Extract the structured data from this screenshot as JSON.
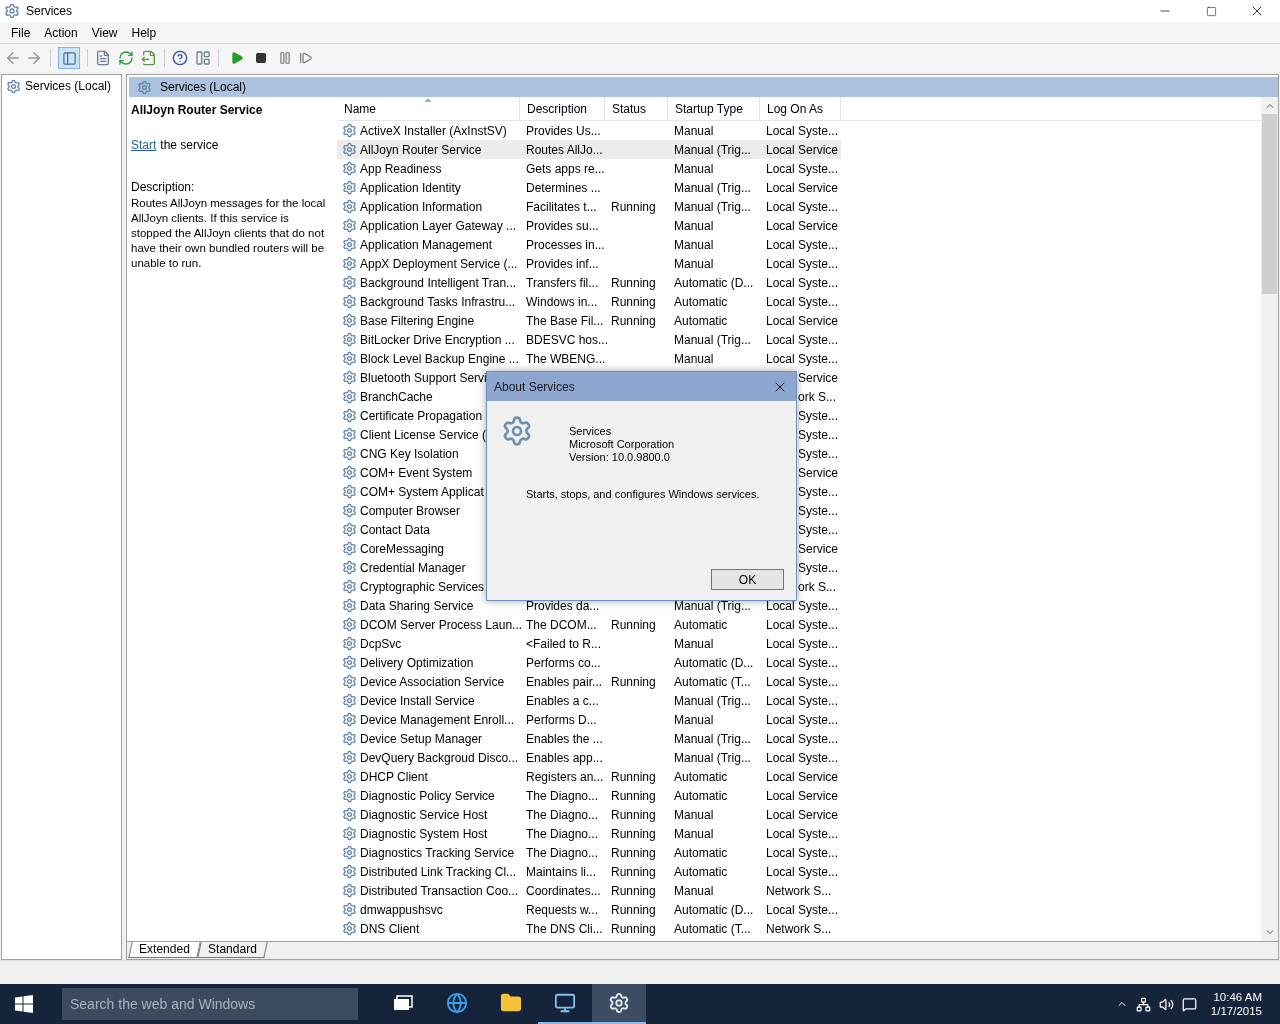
{
  "window": {
    "title": "Services"
  },
  "menu": [
    {
      "label": "File"
    },
    {
      "label": "Action"
    },
    {
      "label": "View"
    },
    {
      "label": "Help"
    }
  ],
  "toolbar": {
    "console_tree_shown": true
  },
  "tree": [
    {
      "label": "Services (Local)"
    }
  ],
  "panel": {
    "title": "Services (Local)",
    "service_name": "AllJoyn Router Service",
    "start_link": "Start",
    "start_suffix": "the service",
    "description_label": "Description:",
    "description": "Routes AllJoyn messages for the local AllJoyn clients. If this service is stopped the AllJoyn clients that do not have their own bundled routers will be unable to run."
  },
  "table": {
    "columns": [
      {
        "label": "Name",
        "sorted": true
      },
      {
        "label": "Description",
        "sorted": false
      },
      {
        "label": "Status",
        "sorted": false
      },
      {
        "label": "Startup Type",
        "sorted": false
      },
      {
        "label": "Log On As",
        "sorted": false
      }
    ],
    "rows": [
      {
        "name": "ActiveX Installer (AxInstSV)",
        "description": "Provides Us...",
        "startup_type": "Manual",
        "log_on_as": "Local Syste...",
        "selected": false
      },
      {
        "name": "AllJoyn Router Service",
        "description": "Routes AllJo...",
        "startup_type": "Manual (Trig...",
        "log_on_as": "Local Service",
        "selected": true
      },
      {
        "name": "App Readiness",
        "description": "Gets apps re...",
        "startup_type": "Manual",
        "log_on_as": "Local Syste...",
        "selected": false
      },
      {
        "name": "Application Identity",
        "description": "Determines ...",
        "startup_type": "Manual (Trig...",
        "log_on_as": "Local Service",
        "selected": false
      },
      {
        "name": "Application Information",
        "description": "Facilitates t...",
        "status": "Running",
        "startup_type": "Manual (Trig...",
        "log_on_as": "Local Syste...",
        "selected": false
      },
      {
        "name": "Application Layer Gateway ...",
        "description": "Provides su...",
        "startup_type": "Manual",
        "log_on_as": "Local Service",
        "selected": false
      },
      {
        "name": "Application Management",
        "description": "Processes in...",
        "startup_type": "Manual",
        "log_on_as": "Local Syste...",
        "selected": false
      },
      {
        "name": "AppX Deployment Service (...",
        "description": "Provides inf...",
        "startup_type": "Manual",
        "log_on_as": "Local Syste...",
        "selected": false
      },
      {
        "name": "Background Intelligent Tran...",
        "description": "Transfers fil...",
        "status": "Running",
        "startup_type": "Automatic (D...",
        "log_on_as": "Local Syste...",
        "selected": false
      },
      {
        "name": "Background Tasks Infrastru...",
        "description": "Windows in...",
        "status": "Running",
        "startup_type": "Automatic",
        "log_on_as": "Local Syste...",
        "selected": false
      },
      {
        "name": "Base Filtering Engine",
        "description": "The Base Fil...",
        "status": "Running",
        "startup_type": "Automatic",
        "log_on_as": "Local Service",
        "selected": false
      },
      {
        "name": "BitLocker Drive Encryption ...",
        "description": "BDESVC hos...",
        "startup_type": "Manual (Trig...",
        "log_on_as": "Local Syste...",
        "selected": false
      },
      {
        "name": "Block Level Backup Engine ...",
        "description": "The WBENG...",
        "startup_type": "Manual",
        "log_on_as": "Local Syste...",
        "selected": false
      },
      {
        "name": "Bluetooth Support Servi",
        "log_on_as": "Service",
        "selected": false
      },
      {
        "name": "BranchCache",
        "log_on_as": "ork S...",
        "selected": false
      },
      {
        "name": "Certificate Propagation",
        "log_on_as": "Syste...",
        "selected": false
      },
      {
        "name": "Client License Service (",
        "log_on_as": "Syste...",
        "selected": false
      },
      {
        "name": "CNG Key Isolation",
        "log_on_as": "Syste...",
        "selected": false
      },
      {
        "name": "COM+ Event System",
        "log_on_as": "Service",
        "selected": false
      },
      {
        "name": "COM+ System Applicat",
        "log_on_as": "Syste...",
        "selected": false
      },
      {
        "name": "Computer Browser",
        "log_on_as": "Syste...",
        "selected": false
      },
      {
        "name": "Contact Data",
        "log_on_as": "Syste...",
        "selected": false
      },
      {
        "name": "CoreMessaging",
        "log_on_as": "Service",
        "selected": false
      },
      {
        "name": "Credential Manager",
        "log_on_as": "Syste...",
        "selected": false
      },
      {
        "name": "Cryptographic Services",
        "log_on_as": "ork S...",
        "selected": false
      },
      {
        "name": "Data Sharing Service",
        "description": "Provides da...",
        "startup_type": "Manual (Trig...",
        "log_on_as": "Local Syste...",
        "selected": false
      },
      {
        "name": "DCOM Server Process Laun...",
        "description": "The DCOM...",
        "status": "Running",
        "startup_type": "Automatic",
        "log_on_as": "Local Syste...",
        "selected": false
      },
      {
        "name": "DcpSvc",
        "description": "<Failed to R...",
        "startup_type": "Manual",
        "log_on_as": "Local Syste...",
        "selected": false
      },
      {
        "name": "Delivery Optimization",
        "description": "Performs co...",
        "startup_type": "Automatic (D...",
        "log_on_as": "Local Syste...",
        "selected": false
      },
      {
        "name": "Device Association Service",
        "description": "Enables pair...",
        "status": "Running",
        "startup_type": "Automatic (T...",
        "log_on_as": "Local Syste...",
        "selected": false
      },
      {
        "name": "Device Install Service",
        "description": "Enables a c...",
        "startup_type": "Manual (Trig...",
        "log_on_as": "Local Syste...",
        "selected": false
      },
      {
        "name": "Device Management Enroll...",
        "description": "Performs D...",
        "startup_type": "Manual",
        "log_on_as": "Local Syste...",
        "selected": false
      },
      {
        "name": "Device Setup Manager",
        "description": "Enables the ...",
        "startup_type": "Manual (Trig...",
        "log_on_as": "Local Syste...",
        "selected": false
      },
      {
        "name": "DevQuery Backgroud Disco...",
        "description": "Enables app...",
        "startup_type": "Manual (Trig...",
        "log_on_as": "Local Syste...",
        "selected": false
      },
      {
        "name": "DHCP Client",
        "description": "Registers an...",
        "status": "Running",
        "startup_type": "Automatic",
        "log_on_as": "Local Service",
        "selected": false
      },
      {
        "name": "Diagnostic Policy Service",
        "description": "The Diagno...",
        "status": "Running",
        "startup_type": "Automatic",
        "log_on_as": "Local Service",
        "selected": false
      },
      {
        "name": "Diagnostic Service Host",
        "description": "The Diagno...",
        "status": "Running",
        "startup_type": "Manual",
        "log_on_as": "Local Service",
        "selected": false
      },
      {
        "name": "Diagnostic System Host",
        "description": "The Diagno...",
        "status": "Running",
        "startup_type": "Manual",
        "log_on_as": "Local Syste...",
        "selected": false
      },
      {
        "name": "Diagnostics Tracking Service",
        "description": "The Diagno...",
        "status": "Running",
        "startup_type": "Automatic",
        "log_on_as": "Local Syste...",
        "selected": false
      },
      {
        "name": "Distributed Link Tracking Cl...",
        "description": "Maintains li...",
        "status": "Running",
        "startup_type": "Automatic",
        "log_on_as": "Local Syste...",
        "selected": false
      },
      {
        "name": "Distributed Transaction Coo...",
        "description": "Coordinates...",
        "status": "Running",
        "startup_type": "Manual",
        "log_on_as": "Network S...",
        "selected": false
      },
      {
        "name": "dmwappushsvc",
        "description": "Requests w...",
        "status": "Running",
        "startup_type": "Automatic (D...",
        "log_on_as": "Local Syste...",
        "selected": false
      },
      {
        "name": "DNS Client",
        "description": "The DNS Cli...",
        "status": "Running",
        "startup_type": "Automatic (T...",
        "log_on_as": "Network S...",
        "selected": false
      }
    ]
  },
  "view_tabs": [
    {
      "label": "Extended",
      "selected": true
    },
    {
      "label": "Standard",
      "selected": false
    }
  ],
  "dialog": {
    "title": "About Services",
    "product": "Services",
    "company": "Microsoft Corporation",
    "version": "Version: 10.0.9800.0",
    "summary": "Starts, stops, and configures Windows services.",
    "ok": "OK"
  },
  "taskbar": {
    "search_placeholder": "Search the web and Windows",
    "apps": [
      {
        "kind": "task-view",
        "running": false,
        "active": false
      },
      {
        "kind": "browser",
        "running": false,
        "active": false
      },
      {
        "kind": "folder",
        "running": false,
        "active": false
      },
      {
        "kind": "control-panel",
        "running": true,
        "active": false
      },
      {
        "kind": "services",
        "running": true,
        "active": true
      }
    ],
    "time": "10:46 AM",
    "date": "1/17/2015"
  }
}
